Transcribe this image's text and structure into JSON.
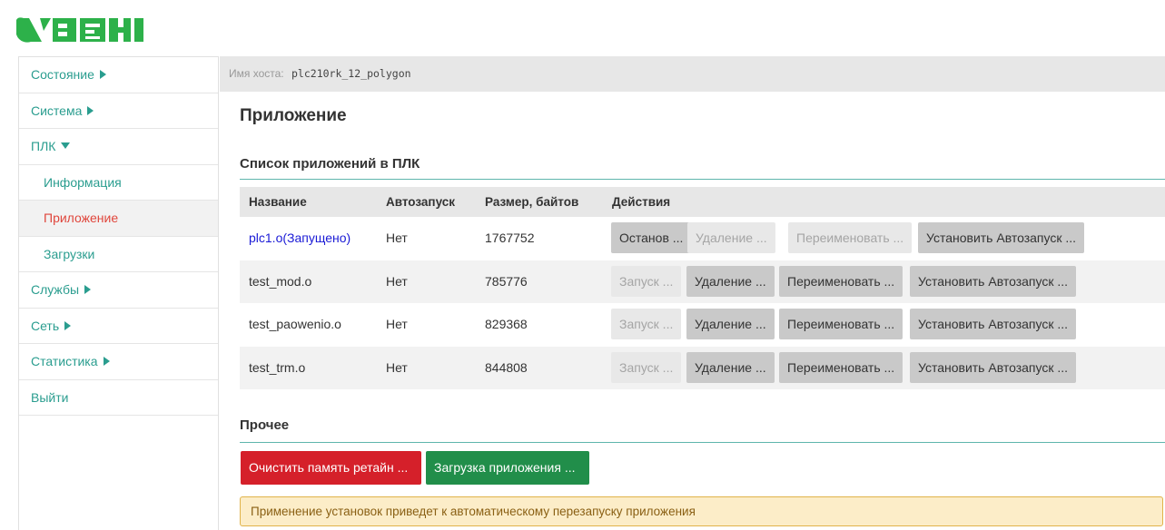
{
  "brand": {
    "logo_text": "ОВЕН",
    "logo_color": "#2db14a"
  },
  "sidebar": {
    "items": [
      {
        "label": "Состояние",
        "expandable": true,
        "expanded": false
      },
      {
        "label": "Система",
        "expandable": true,
        "expanded": false
      },
      {
        "label": "ПЛК",
        "expandable": true,
        "expanded": true
      },
      {
        "label": "Информация",
        "sub": true
      },
      {
        "label": "Приложение",
        "sub": true,
        "active": true
      },
      {
        "label": "Загрузки",
        "sub": true
      },
      {
        "label": "Службы",
        "expandable": true,
        "expanded": false
      },
      {
        "label": "Сеть",
        "expandable": true,
        "expanded": false
      },
      {
        "label": "Статистика",
        "expandable": true,
        "expanded": false
      },
      {
        "label": "Выйти"
      }
    ]
  },
  "host": {
    "label": "Имя хоста:",
    "value": "plc210rk_12_polygon"
  },
  "page": {
    "title": "Приложение"
  },
  "apps": {
    "section_title": "Список приложений в ПЛК",
    "columns": [
      "Название",
      "Автозапуск",
      "Размер, байтов",
      "Действия"
    ],
    "rows": [
      {
        "name": "plc1.o(Запущено)",
        "autostart": "Нет",
        "size": "1767752",
        "running": true,
        "actions": [
          {
            "label": "Останов ...",
            "enabled": true
          },
          {
            "label": "Удаление ...",
            "enabled": false
          },
          {
            "label": "Переименовать ...",
            "enabled": false
          },
          {
            "label": "Установить Автозапуск ...",
            "enabled": true
          }
        ]
      },
      {
        "name": "test_mod.o",
        "autostart": "Нет",
        "size": "785776",
        "running": false,
        "actions": [
          {
            "label": "Запуск ...",
            "enabled": false
          },
          {
            "label": "Удаление ...",
            "enabled": true
          },
          {
            "label": "Переименовать ...",
            "enabled": true
          },
          {
            "label": "Установить Автозапуск ...",
            "enabled": true
          }
        ]
      },
      {
        "name": "test_paowenio.o",
        "autostart": "Нет",
        "size": "829368",
        "running": false,
        "actions": [
          {
            "label": "Запуск ...",
            "enabled": false
          },
          {
            "label": "Удаление ...",
            "enabled": true
          },
          {
            "label": "Переименовать ...",
            "enabled": true
          },
          {
            "label": "Установить Автозапуск ...",
            "enabled": true
          }
        ]
      },
      {
        "name": "test_trm.o",
        "autostart": "Нет",
        "size": "844808",
        "running": false,
        "actions": [
          {
            "label": "Запуск ...",
            "enabled": false
          },
          {
            "label": "Удаление ...",
            "enabled": true
          },
          {
            "label": "Переименовать ...",
            "enabled": true
          },
          {
            "label": "Установить Автозапуск ...",
            "enabled": true
          }
        ]
      }
    ]
  },
  "other": {
    "section_title": "Прочее",
    "clear_retain_label": "Очистить память ретайн ...",
    "upload_app_label": "Загрузка приложения ...",
    "warning": "Применение установок приведет к автоматическому перезапуску приложения"
  },
  "colors": {
    "accent": "#2a9d8f",
    "active_nav": "#e0463c",
    "danger": "#d5202a",
    "success": "#218e4a",
    "warning_bg": "#fcedc8",
    "running_link": "#1a1ad6"
  }
}
